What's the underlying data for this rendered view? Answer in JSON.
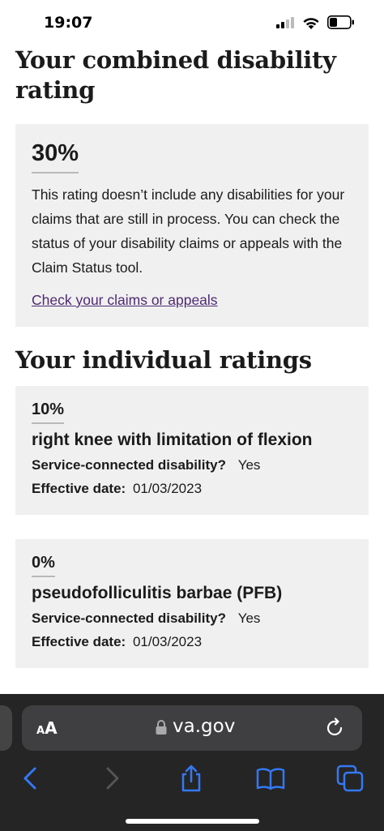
{
  "status_bar": {
    "time": "19:07"
  },
  "page_title": "Your combined disability rating",
  "summary": {
    "combined_rating": "30%",
    "description": "This rating doesn’t include any disabilities for your claims that are still in process. You can check the status of your disability claims or appeals with the Claim Status tool.",
    "link_text": "Check your claims or appeals"
  },
  "individual_section_title": "Your individual ratings",
  "ratings": [
    {
      "percent": "10%",
      "name": "right knee with limitation of flexion",
      "service_connected_label": "Service-connected disability?",
      "service_connected_value": "Yes",
      "effective_date_label": "Effective date:",
      "effective_date_value": "01/03/2023"
    },
    {
      "percent": "0%",
      "name": "pseudofolliculitis barbae (PFB)",
      "service_connected_label": "Service-connected disability?",
      "service_connected_value": "Yes",
      "effective_date_label": "Effective date:",
      "effective_date_value": "01/03/2023"
    }
  ],
  "browser": {
    "text_size_small": "A",
    "text_size_large": "A",
    "url": "va.gov",
    "icons": [
      "lock-icon",
      "reload-icon",
      "back-icon",
      "forward-icon",
      "share-icon",
      "bookmarks-icon",
      "tabs-icon"
    ]
  },
  "colors": {
    "link": "#4f2a73",
    "card_background": "#f0f0f0",
    "toolbar_background": "#252525",
    "toolbar_icon": "#3478f6"
  }
}
